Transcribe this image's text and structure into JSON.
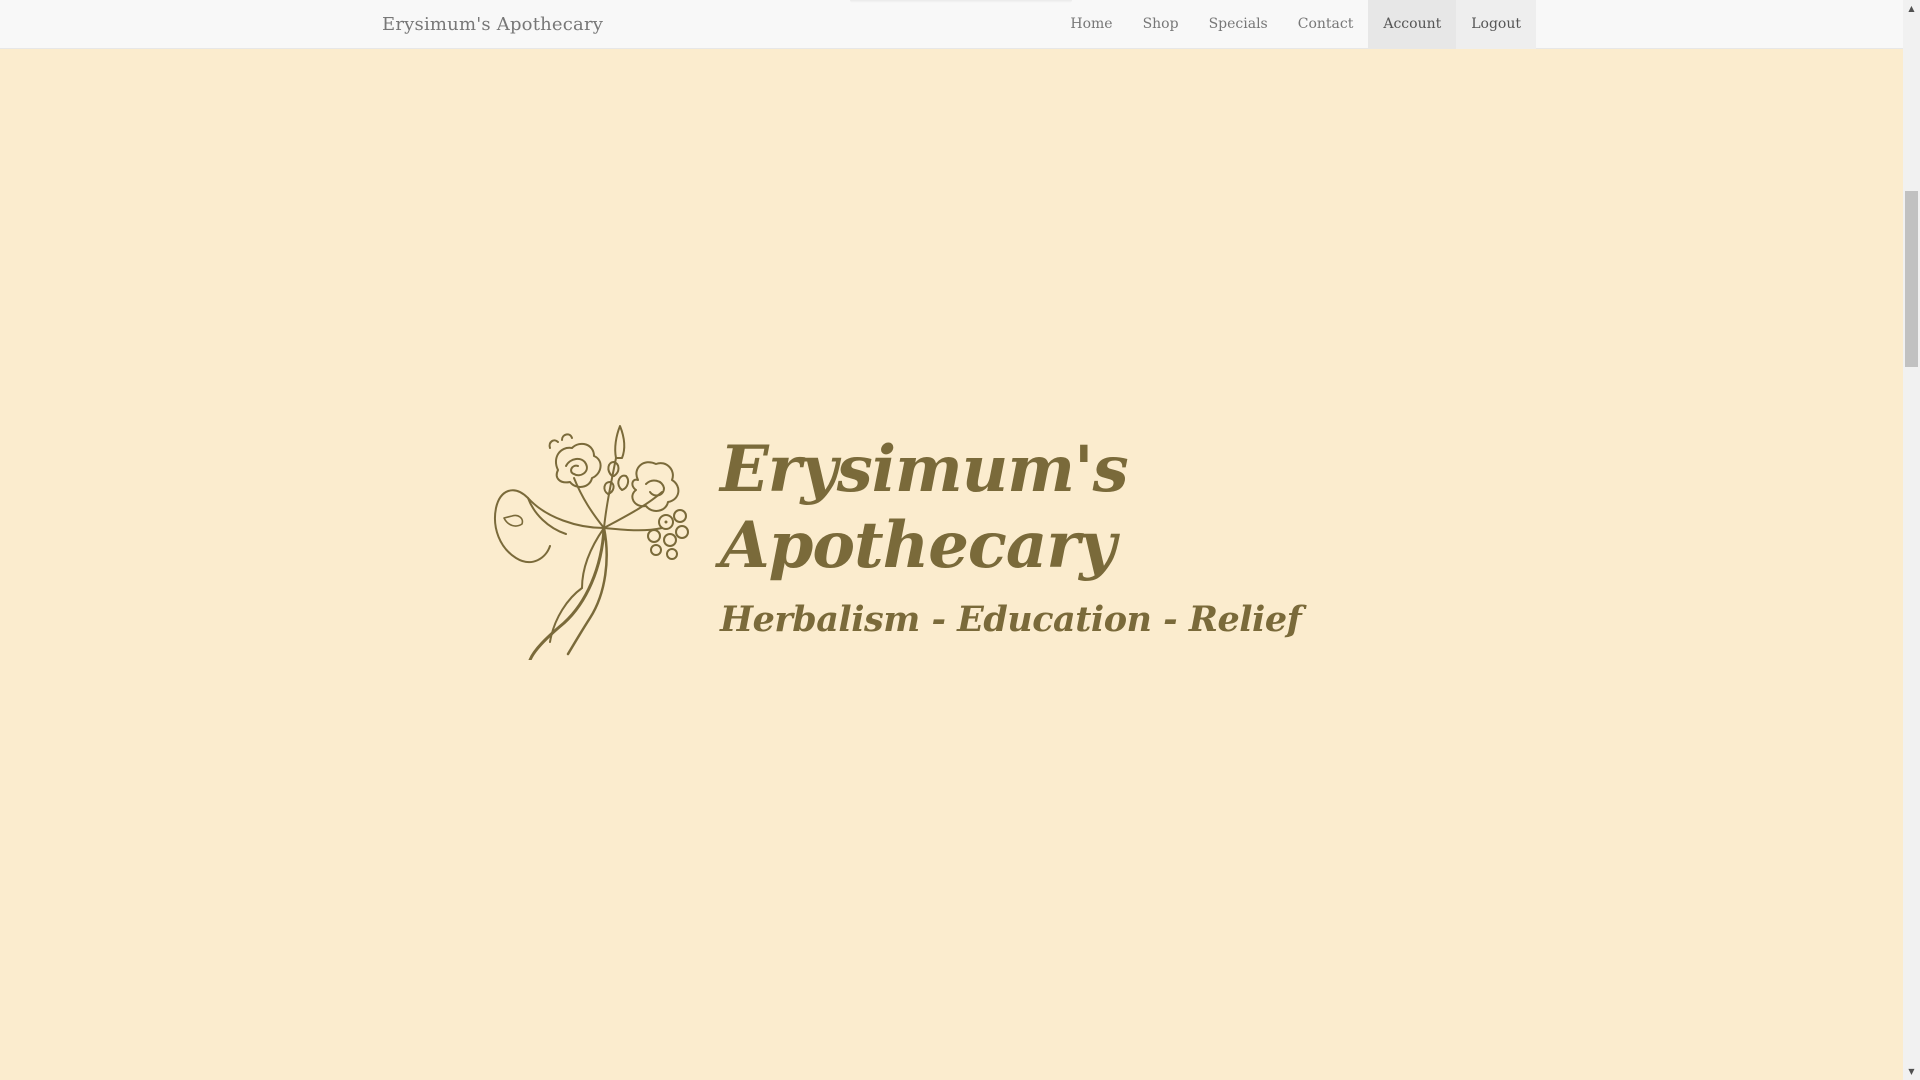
{
  "navbar": {
    "brand": "Erysimum's Apothecary",
    "items": [
      {
        "label": "Home"
      },
      {
        "label": "Shop"
      },
      {
        "label": "Specials"
      },
      {
        "label": "Contact"
      },
      {
        "label": "Account"
      },
      {
        "label": "Logout"
      }
    ]
  },
  "hero": {
    "title_line1": "Erysimum's",
    "title_line2": "Apothecary",
    "tagline": "Herbalism - Education - Relief",
    "logo_icon": "botanical-flower-illustration"
  },
  "scrollbar": {
    "up_arrow": "▲",
    "down_arrow": "▼"
  },
  "colors": {
    "background": "#fbecce",
    "brand_text": "#7a6a3a",
    "nav_bg": "#f8f8f8",
    "nav_active_bg": "#e7e7e7"
  }
}
